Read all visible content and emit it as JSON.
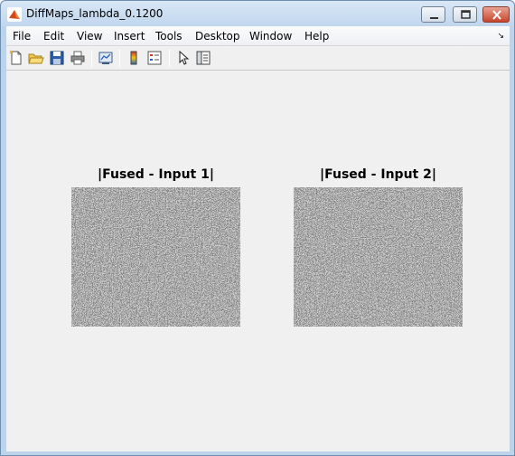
{
  "window": {
    "title": "DiffMaps_lambda_0.1200"
  },
  "menubar": {
    "items": [
      "File",
      "Edit",
      "View",
      "Insert",
      "Tools",
      "Desktop",
      "Window",
      "Help"
    ]
  },
  "toolbar": {
    "buttons": [
      "new-figure",
      "open-file",
      "save",
      "print",
      "link-plot",
      "insert-colorbar",
      "insert-legend",
      "edit-plot",
      "property-inspector"
    ]
  },
  "figure": {
    "subplots": [
      {
        "title": "|Fused - Input 1|"
      },
      {
        "title": "|Fused - Input 2|"
      }
    ]
  }
}
